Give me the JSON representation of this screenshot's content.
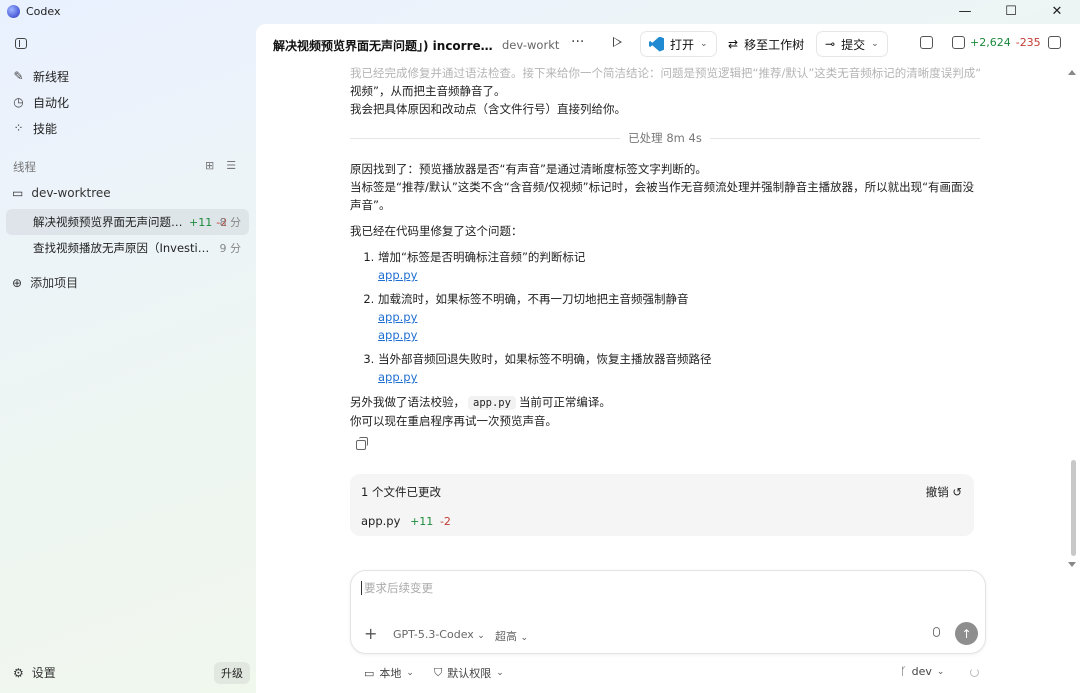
{
  "app": {
    "title": "Codex"
  },
  "window_controls": {
    "minimize": "—",
    "maximize": "☐",
    "close": "✕"
  },
  "sidebar": {
    "nav": [
      {
        "label": "新线程",
        "icon": "new-thread-icon"
      },
      {
        "label": "自动化",
        "icon": "clock-icon"
      },
      {
        "label": "技能",
        "icon": "skills-icon"
      }
    ],
    "section_label": "线程",
    "folder": "dev-worktree",
    "threads": [
      {
        "title": "解决视频预览界面无声问题…",
        "added": "+11",
        "removed": "-2",
        "time": "8 分"
      },
      {
        "title": "查找视频播放无声原因（Investigat…",
        "time": "9 分"
      }
    ],
    "add_project": "添加项目",
    "settings": "设置",
    "upgrade": "升级"
  },
  "topbar": {
    "title": "解决视频预览界面无声问题」) incorrect; ne...",
    "branch": "dev-worktree",
    "more": "···",
    "open_label": "打开",
    "move_label": "移至工作树",
    "commit_label": "提交",
    "diff_added": "+2,624",
    "diff_removed": "-235"
  },
  "conversation": {
    "faded_line1": "我已经完成修复并通过语法检查。接下来给你一个简洁结论：问题是预览逻辑把“推荐/默认”这类无音频标记的清晰度误判成“仅",
    "faded_line2": "视频”，从而把主音频静音了。",
    "line3": "我会把具体原因和改动点（含文件行号）直接列给你。",
    "processed": "已处理 8m 4s",
    "cause_1": "原因找到了：预览播放器是否“有声音”是通过清晰度标签文字判断的。",
    "cause_2": "当标签是“推荐/默认”这类不含“含音频/仅视频”标记时，会被当作无音频流处理并强制静音主播放器，所以就出现“有画面没声音”。",
    "fixed_intro": "我已经在代码里修复了这个问题：",
    "fixes": [
      {
        "text": "增加“标签是否明确标注音频”的判断标记",
        "links": [
          "app.py"
        ]
      },
      {
        "text": "加载流时，如果标签不明确，不再一刀切地把主音频强制静音",
        "links": [
          "app.py",
          "app.py"
        ]
      },
      {
        "text": "当外部音频回退失败时，如果标签不明确，恢复主播放器音频路径",
        "links": [
          "app.py"
        ]
      }
    ],
    "syntax_pre": "另外我做了语法校验，",
    "syntax_code": "app.py",
    "syntax_post": "当前可正常编译。",
    "retry": "你可以现在重启程序再试一次预览声音。"
  },
  "change_card": {
    "title": "1 个文件已更改",
    "undo": "撤销",
    "file": "app.py",
    "added": "+11",
    "removed": "-2"
  },
  "composer": {
    "placeholder": "要求后续变更",
    "model": "GPT-5.3-Codex",
    "effort": "超高"
  },
  "footer": {
    "location": "本地",
    "permission": "默认权限",
    "branch": "dev"
  }
}
